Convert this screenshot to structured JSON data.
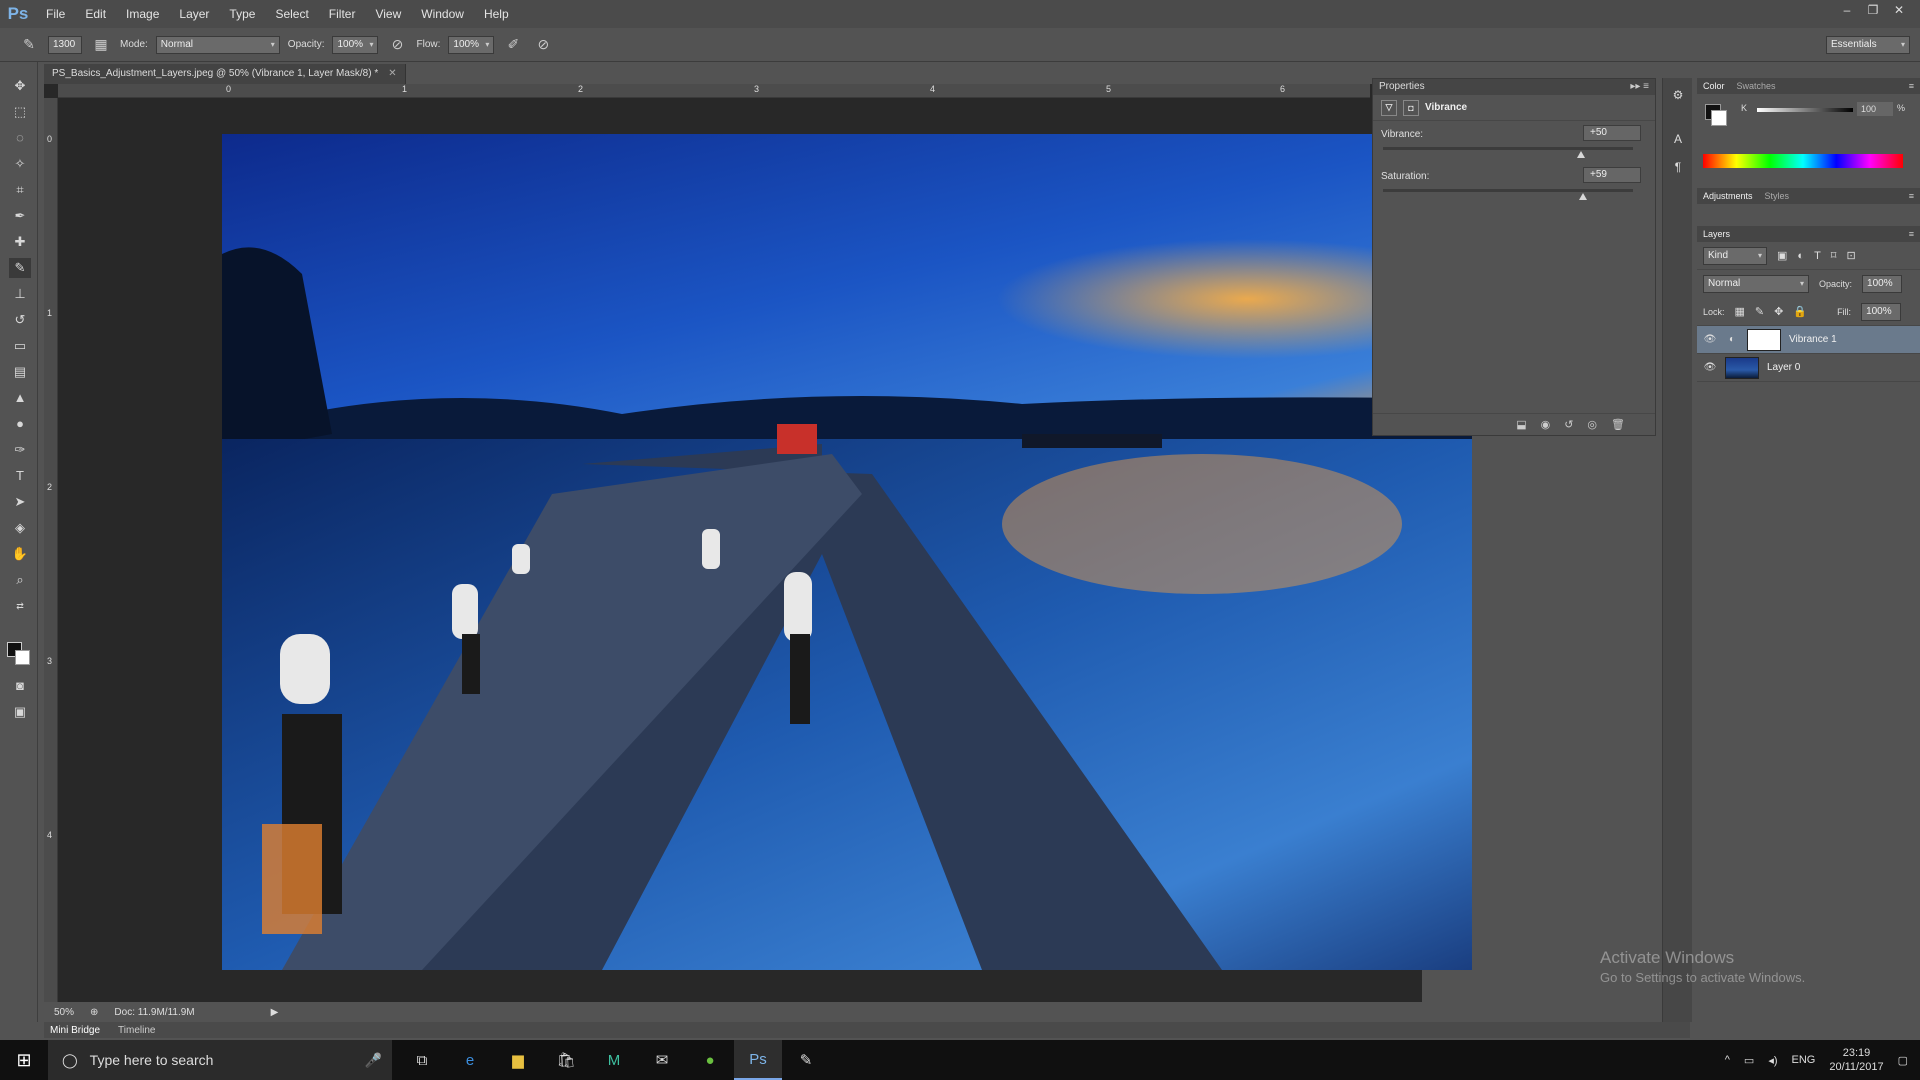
{
  "app": {
    "logo": "Ps",
    "menu": [
      "File",
      "Edit",
      "Image",
      "Layer",
      "Type",
      "Select",
      "Filter",
      "View",
      "Window",
      "Help"
    ],
    "window_controls": [
      "–",
      "❐",
      "✕"
    ]
  },
  "options_bar": {
    "brush_size": "1300",
    "mode_label": "Mode:",
    "mode_value": "Normal",
    "opacity_label": "Opacity:",
    "opacity_value": "100%",
    "flow_label": "Flow:",
    "flow_value": "100%",
    "workspace": "Essentials"
  },
  "document": {
    "tab_title": "PS_Basics_Adjustment_Layers.jpeg @ 50% (Vibrance 1, Layer Mask/8) *",
    "ruler_top": [
      "0",
      "1",
      "2",
      "3",
      "4",
      "5",
      "6"
    ],
    "ruler_left": [
      "0",
      "1",
      "2",
      "3",
      "4"
    ]
  },
  "status": {
    "zoom": "50%",
    "doc_info": "Doc: 11.9M/11.9M"
  },
  "bottom_tabs": [
    "Mini Bridge",
    "Timeline"
  ],
  "properties": {
    "panel_title": "Properties",
    "adjustment_name": "Vibrance",
    "sliders": [
      {
        "label": "Vibrance:",
        "value": "+50",
        "fraction": 0.79
      },
      {
        "label": "Saturation:",
        "value": "+59",
        "fraction": 0.8
      }
    ]
  },
  "color_panel": {
    "tabs": [
      "Color",
      "Swatches"
    ],
    "channel_label": "K",
    "channel_value": "100",
    "channel_unit": "%"
  },
  "adjustments_panel": {
    "tabs": [
      "Adjustments",
      "Styles"
    ]
  },
  "layers_panel": {
    "title": "Layers",
    "kind_filter": "Kind",
    "blend_mode": "Normal",
    "opacity_label": "Opacity:",
    "opacity_value": "100%",
    "lock_label": "Lock:",
    "fill_label": "Fill:",
    "fill_value": "100%",
    "layers": [
      {
        "name": "Vibrance 1",
        "selected": true
      },
      {
        "name": "Layer 0",
        "selected": false
      }
    ]
  },
  "watermark": {
    "line1": "Activate Windows",
    "line2": "Go to Settings to activate Windows."
  },
  "taskbar": {
    "search_placeholder": "Type here to search",
    "language": "ENG",
    "time": "23:19",
    "date": "20/11/2017"
  },
  "colors": {
    "accent_selected_layer": "#6a7a8c",
    "ps_blue": "#7eb4e8"
  }
}
